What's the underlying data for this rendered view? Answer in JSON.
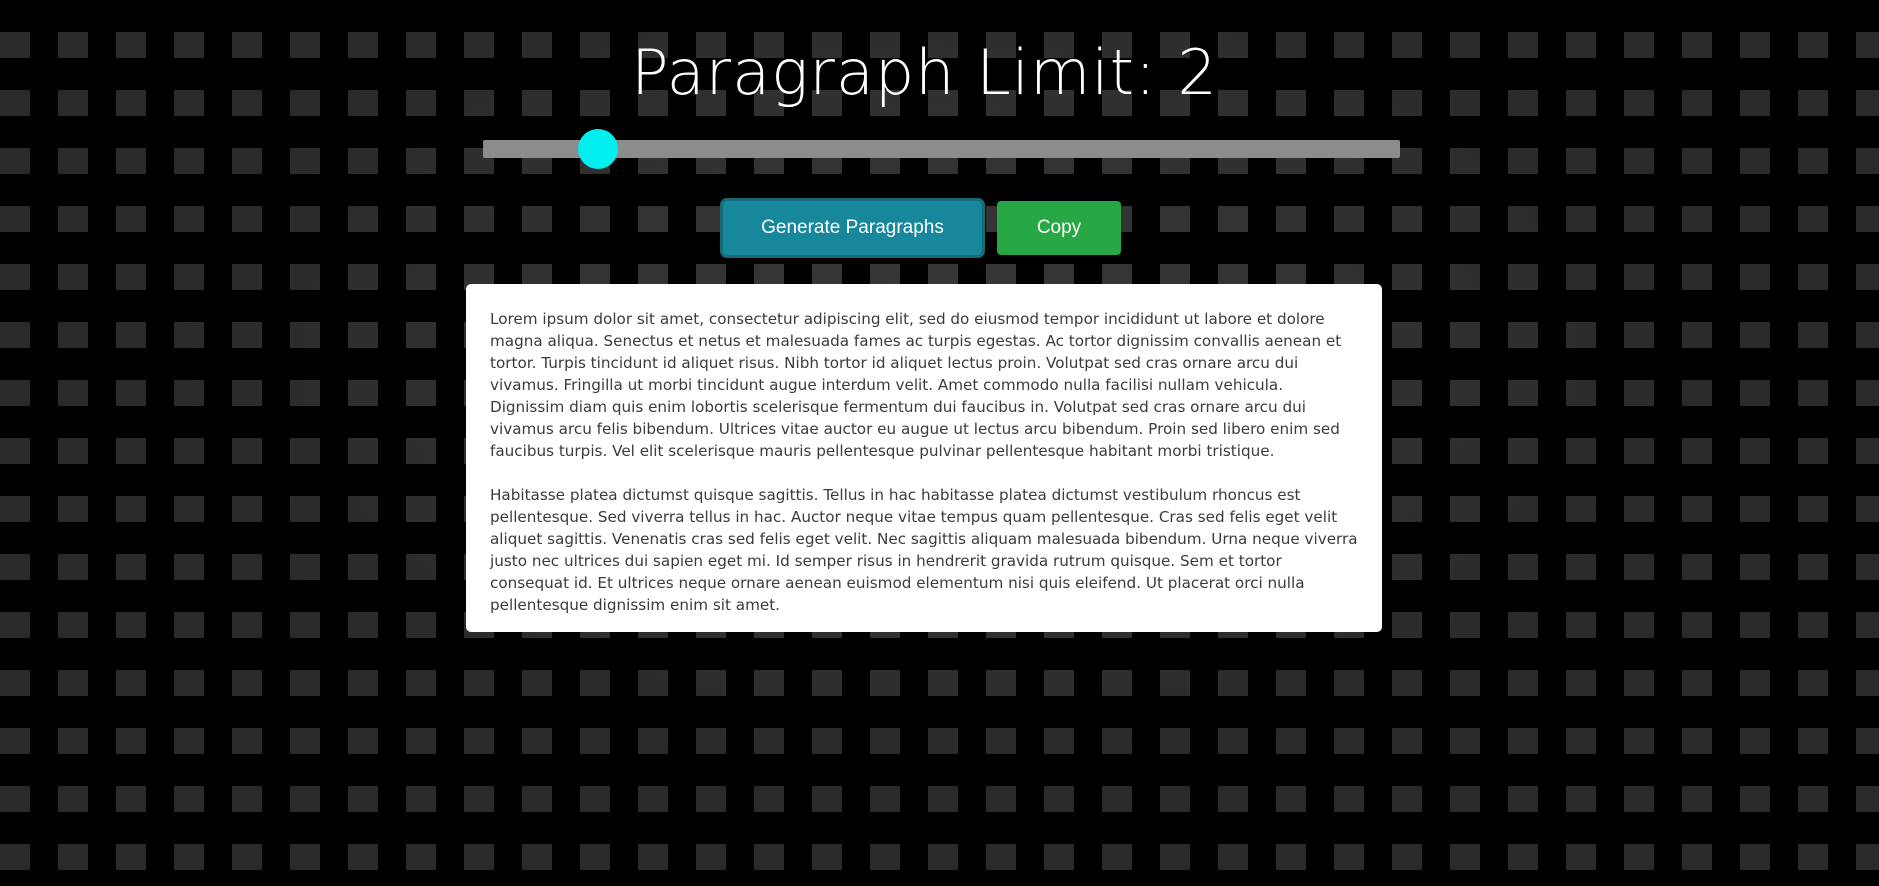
{
  "header": {
    "title": "Paragraph Limit: 2"
  },
  "slider": {
    "value": 2,
    "min": 1,
    "max": 10,
    "thumb_color": "#00f0f0",
    "track_color": "#8c8c8c"
  },
  "buttons": {
    "generate_label": "Generate Paragraphs",
    "copy_label": "Copy"
  },
  "colors": {
    "generate_button": "#17879b",
    "copy_button": "#28a745",
    "background": "#2a2a2a"
  },
  "paragraphs": [
    "Lorem ipsum dolor sit amet, consectetur adipiscing elit, sed do eiusmod tempor incididunt ut labore et dolore magna aliqua. Senectus et netus et malesuada fames ac turpis egestas. Ac tortor dignissim convallis aenean et tortor. Turpis tincidunt id aliquet risus. Nibh tortor id aliquet lectus proin. Volutpat sed cras ornare arcu dui vivamus. Fringilla ut morbi tincidunt augue interdum velit. Amet commodo nulla facilisi nullam vehicula. Dignissim diam quis enim lobortis scelerisque fermentum dui faucibus in. Volutpat sed cras ornare arcu dui vivamus arcu felis bibendum. Ultrices vitae auctor eu augue ut lectus arcu bibendum. Proin sed libero enim sed faucibus turpis. Vel elit scelerisque mauris pellentesque pulvinar pellentesque habitant morbi tristique.",
    "Habitasse platea dictumst quisque sagittis. Tellus in hac habitasse platea dictumst vestibulum rhoncus est pellentesque. Sed viverra tellus in hac. Auctor neque vitae tempus quam pellentesque. Cras sed felis eget velit aliquet sagittis. Venenatis cras sed felis eget velit. Nec sagittis aliquam malesuada bibendum. Urna neque viverra justo nec ultrices dui sapien eget mi. Id semper risus in hendrerit gravida rutrum quisque. Sem et tortor consequat id. Et ultrices neque ornare aenean euismod elementum nisi quis eleifend. Ut placerat orci nulla pellentesque dignissim enim sit amet."
  ]
}
